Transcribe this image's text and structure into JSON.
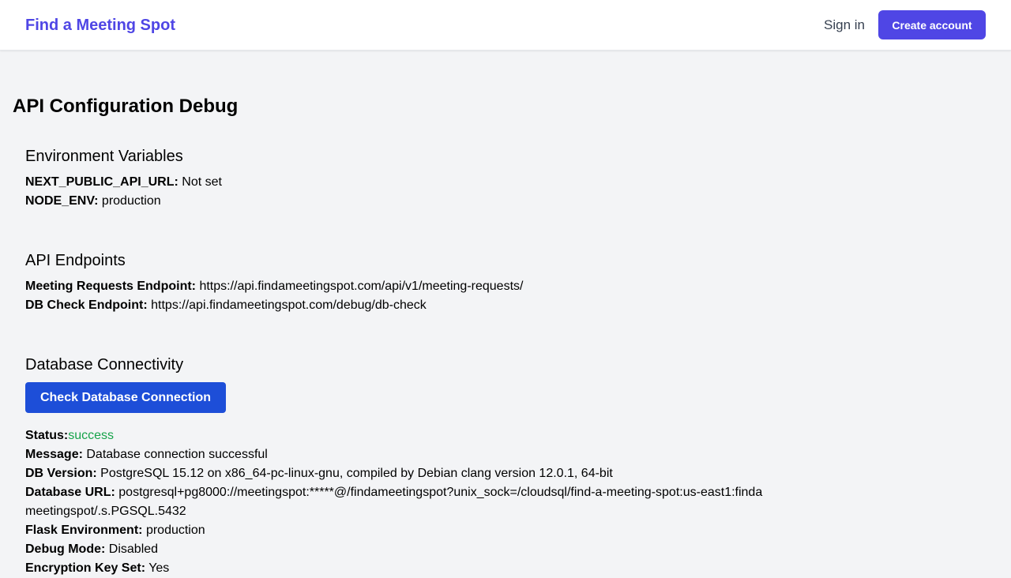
{
  "header": {
    "brand": "Find a Meeting Spot",
    "sign_in": "Sign in",
    "create_account": "Create account"
  },
  "page": {
    "title": "API Configuration Debug"
  },
  "env": {
    "heading": "Environment Variables",
    "items": [
      {
        "label": "NEXT_PUBLIC_API_URL:",
        "value": "Not set"
      },
      {
        "label": "NODE_ENV:",
        "value": "production"
      }
    ]
  },
  "endpoints": {
    "heading": "API Endpoints",
    "items": [
      {
        "label": "Meeting Requests Endpoint:",
        "value": "https://api.findameetingspot.com/api/v1/meeting-requests/"
      },
      {
        "label": "DB Check Endpoint:",
        "value": "https://api.findameetingspot.com/debug/db-check"
      }
    ]
  },
  "db": {
    "heading": "Database Connectivity",
    "check_button": "Check Database Connection",
    "status_label": "Status:",
    "status_value": "success",
    "status_color": "#16a34a",
    "items": [
      {
        "label": "Message:",
        "value": "Database connection successful"
      },
      {
        "label": "DB Version:",
        "value": "PostgreSQL 15.12 on x86_64-pc-linux-gnu, compiled by Debian clang version 12.0.1, 64-bit"
      },
      {
        "label": "Database URL:",
        "value": "postgresql+pg8000://meetingspot:*****@/findameetingspot?unix_sock=/cloudsql/find-a-meeting-spot:us-east1:findameetingspot/.s.PGSQL.5432"
      },
      {
        "label": "Flask Environment:",
        "value": "production"
      },
      {
        "label": "Debug Mode:",
        "value": "Disabled"
      },
      {
        "label": "Encryption Key Set:",
        "value": "Yes"
      }
    ]
  },
  "colors": {
    "brand": "#4f46e5",
    "primary_button": "#4f46e5",
    "check_button": "#1d4ed8",
    "background": "#f3f4f6"
  }
}
